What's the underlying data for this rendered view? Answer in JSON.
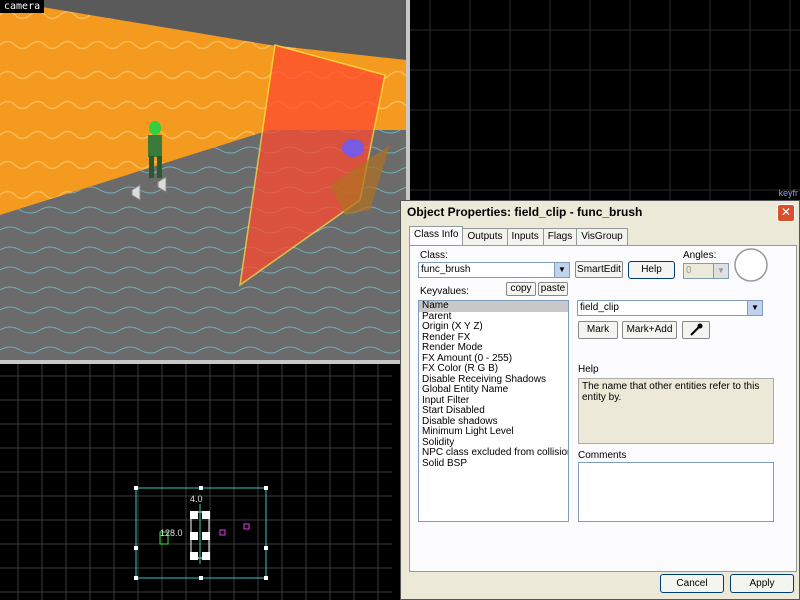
{
  "viewports": {
    "camera_label": "camera",
    "top_right_label": "keyfr",
    "bottom_left": {
      "dim_width": "4.0",
      "dim_height": "128.0"
    }
  },
  "dialog": {
    "title": "Object Properties: field_clip - func_brush",
    "close_glyph": "✕",
    "tabs": [
      "Class Info",
      "Outputs",
      "Inputs",
      "Flags",
      "VisGroup"
    ],
    "class_label": "Class:",
    "class_value": "func_brush",
    "smartedit_label": "SmartEdit",
    "help_button_label": "Help",
    "angles_label": "Angles:",
    "angles_value": "0",
    "keyvalues_label": "Keyvalues:",
    "copy_label": "copy",
    "paste_label": "paste",
    "keyvalues": [
      "Name",
      "Parent",
      "Origin (X Y Z)",
      "Render FX",
      "Render Mode",
      "FX Amount (0 - 255)",
      "FX Color (R G B)",
      "Disable Receiving Shadows",
      "Global Entity Name",
      "Input Filter",
      "Start Disabled",
      "Disable shadows",
      "Minimum Light Level",
      "Solidity",
      "NPC class excluded from collisions",
      "Solid BSP"
    ],
    "value_field": "field_clip",
    "mark_label": "Mark",
    "mark_add_label": "Mark+Add",
    "help_section_label": "Help",
    "help_text": "The name that other entities refer to this entity by.",
    "comments_label": "Comments",
    "cancel_label": "Cancel",
    "apply_label": "Apply"
  }
}
